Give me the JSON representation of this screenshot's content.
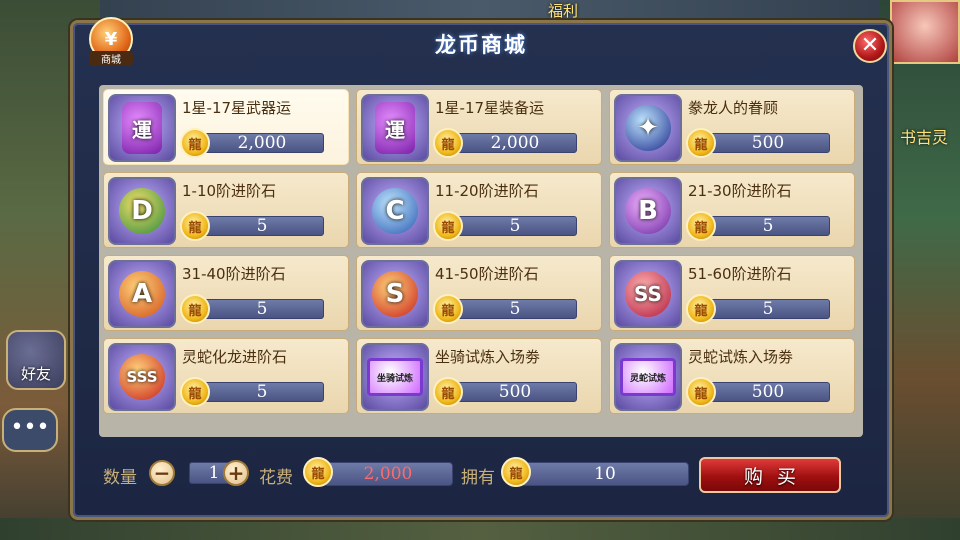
{
  "background": {
    "top_label": "福利",
    "right_label": "书吉灵",
    "side_button_label": "好友",
    "chat_icon": "chat-bubble-icon"
  },
  "panel": {
    "title": "龙币商城",
    "shop_badge_label": "商城",
    "shop_badge_glyph": "¥",
    "close_glyph": "✕"
  },
  "items": [
    {
      "name": "1星-17星武器运",
      "price": "2,000",
      "icon": "scroll-icon",
      "glyph": "運",
      "colors": [
        "#e58cff",
        "#7a1fa8"
      ],
      "selected": true
    },
    {
      "name": "1星-17星装备运",
      "price": "2,000",
      "icon": "scroll-icon",
      "glyph": "運",
      "colors": [
        "#e58cff",
        "#7a1fa8"
      ],
      "selected": false
    },
    {
      "name": "豢龙人的眷顾",
      "price": "500",
      "icon": "dragon-blessing-icon",
      "glyph": "✦",
      "colors": [
        "#bfe6ff",
        "#1a2a8a"
      ],
      "selected": false
    },
    {
      "name": "1-10阶进阶石",
      "price": "5",
      "icon": "stone-d-icon",
      "glyph": "D",
      "colors": [
        "#f3e06a",
        "#2f8a3a"
      ],
      "selected": false
    },
    {
      "name": "11-20阶进阶石",
      "price": "5",
      "icon": "stone-c-icon",
      "glyph": "C",
      "colors": [
        "#bfe6ff",
        "#2a5ab0"
      ],
      "selected": false
    },
    {
      "name": "21-30阶进阶石",
      "price": "5",
      "icon": "stone-b-icon",
      "glyph": "B",
      "colors": [
        "#f0b0ff",
        "#6a2aa0"
      ],
      "selected": false
    },
    {
      "name": "31-40阶进阶石",
      "price": "5",
      "icon": "stone-a-icon",
      "glyph": "A",
      "colors": [
        "#ffd27a",
        "#d0501a"
      ],
      "selected": false
    },
    {
      "name": "41-50阶进阶石",
      "price": "5",
      "icon": "stone-s-icon",
      "glyph": "S",
      "colors": [
        "#ffd27a",
        "#c8201a"
      ],
      "selected": false
    },
    {
      "name": "51-60阶进阶石",
      "price": "5",
      "icon": "stone-ss-icon",
      "glyph": "SS",
      "colors": [
        "#ffb0b0",
        "#b01a3a"
      ],
      "selected": false
    },
    {
      "name": "灵蛇化龙进阶石",
      "price": "5",
      "icon": "stone-sss-icon",
      "glyph": "SSS",
      "colors": [
        "#ffd27a",
        "#c8201a"
      ],
      "selected": false
    },
    {
      "name": "坐骑试炼入场劵",
      "price": "500",
      "icon": "ticket-icon",
      "glyph": "坐骑试炼",
      "colors": [
        "#ffffff",
        "#d06aff"
      ],
      "selected": false
    },
    {
      "name": "灵蛇试炼入场劵",
      "price": "500",
      "icon": "ticket-icon",
      "glyph": "灵蛇试炼",
      "colors": [
        "#ffffff",
        "#d06aff"
      ],
      "selected": false
    }
  ],
  "bottom": {
    "qty_label": "数量",
    "qty_value": "1",
    "minus_glyph": "−",
    "plus_glyph": "+",
    "cost_label": "花费",
    "cost_value": "2,000",
    "own_label": "拥有",
    "own_value": "10",
    "buy_label": "购买"
  },
  "colors": {
    "cost_text": "#ff6a6a",
    "own_text": "#ffffff"
  }
}
